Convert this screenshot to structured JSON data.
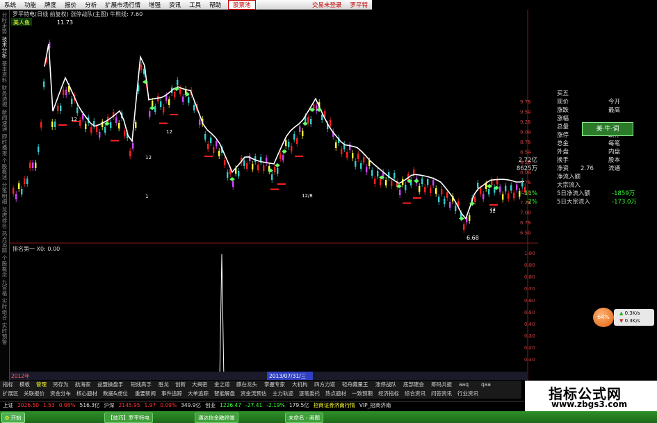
{
  "menu": {
    "items": [
      "系统",
      "功能",
      "牌度",
      "报价",
      "分析",
      "扩展市场行情",
      "增强",
      "资讯",
      "工具",
      "帮助"
    ],
    "special": "股票池",
    "right_items": [
      "交易未登录",
      "罗平特"
    ]
  },
  "left_tabs": [
    "分时走势",
    "技术分析",
    "基本资料",
    "财务透视",
    "新闻速递",
    "即时播报",
    "个股概述",
    "分笔明细",
    "龙虎排名",
    "热点追踪",
    "个股概念",
    "九宫格",
    "实时组合",
    "实时预警"
  ],
  "chart": {
    "title": "罗平特电(日线 前复权) 涨停战队(主图) 牛熊线: 7.60",
    "strategy_label": "美人鱼",
    "peak_label": "11.73",
    "low_label": "6.68",
    "indicator_title": "排名第一  X0: 0.00",
    "date_label": "2013/07/31/三",
    "date_start": "2012年",
    "price_ticks": [
      "9.75",
      "9.50",
      "9.25",
      "9.00",
      "8.75",
      "8.50",
      "8.25",
      "8.00",
      "7.75",
      "7.50",
      "7.25",
      "7.00",
      "6.75",
      "6.50"
    ],
    "indicator_ticks": [
      "1.00",
      "0.90",
      "0.80",
      "0.70",
      "0.60",
      "0.50",
      "0.40",
      "0.30",
      "0.20",
      "0.10"
    ],
    "markers": [
      "12",
      "12",
      "12",
      "1",
      "12",
      "12",
      "12/8"
    ],
    "colors": {
      "white_line": "#ffffff",
      "yellow": "#ffff33",
      "magenta": "#cc44ff",
      "cyan": "#33cccc",
      "red": "#ff2020",
      "green_sign": "#66ff66"
    }
  },
  "right_panel": {
    "rows": [
      {
        "label": "买五",
        "value": "",
        "label2": "",
        "value2": ""
      },
      {
        "label": "现价",
        "value": "",
        "label2": "今开",
        "value2": ""
      },
      {
        "label": "涨跌",
        "value": "",
        "label2": "最高",
        "value2": ""
      },
      {
        "label": "涨幅",
        "value": "",
        "label2": "",
        "value2": ""
      },
      {
        "label": "总量",
        "value": "",
        "label2": "",
        "value2": ""
      },
      {
        "label": "涨停",
        "value": "",
        "label2": "跌停",
        "value2": ""
      },
      {
        "label": "总金",
        "value": "",
        "label2": "每笔",
        "value2": ""
      },
      {
        "label": "外盘",
        "value": "",
        "label2": "内盘",
        "value2": ""
      },
      {
        "label": "换手",
        "value": "",
        "label2": "股本",
        "value2": "2.72亿"
      },
      {
        "label": "净资",
        "value": "2.76",
        "label2": "流通",
        "value2": "8625万"
      },
      {
        "label": "净流入额",
        "value": "",
        "label2": "",
        "value2": ""
      },
      {
        "label": "大宗流入",
        "value": "",
        "label2": "",
        "value2": ""
      },
      {
        "label": "5日净流入额",
        "value": "-1859万",
        "label2": "",
        "value2": "-11%"
      },
      {
        "label": "5日大宗流入",
        "value": "-173.0万",
        "label2": "",
        "value2": "-2%"
      }
    ],
    "badge": "美·牛·词"
  },
  "speed_widget": {
    "percent": "64%",
    "up": "0.3K/s",
    "down": "0.3K/s"
  },
  "bottom_tabs": [
    "指标",
    "模板",
    "管理",
    "另存为",
    "航海家",
    "益盟操盘手",
    "短线高手",
    "胜龙",
    "创新",
    "大揭密",
    "金之道",
    "麒在龙头",
    "掌握专家",
    "大机构",
    "四方力道",
    "轻舟藏量王",
    "涨停战队",
    "底部建会",
    "筹码共振",
    "aaq",
    "qaa"
  ],
  "bottom_tabs_row2": [
    "扩展区",
    "关联报价",
    "资金分布",
    "核心题材",
    "数据&虎位",
    "重要新闻",
    "事件追踪",
    "大单追踪",
    "智能解盘",
    "资金流预估",
    "主力轨迹",
    "逐笔委托",
    "热点题材",
    "一致预期",
    "经济指标",
    "综合资讯",
    "问答资讯",
    "行业资讯"
  ],
  "status_bar": [
    {
      "text": "上证",
      "color": "#dddddd"
    },
    {
      "text": "2026.50",
      "color": "#ff3333"
    },
    {
      "text": "1.53",
      "color": "#ff3333"
    },
    {
      "text": "0.08%",
      "color": "#ff3333"
    },
    {
      "text": "516.3亿",
      "color": "#dddddd"
    },
    {
      "text": "沪深",
      "color": "#dddddd"
    },
    {
      "text": "2145.95",
      "color": "#ff3333"
    },
    {
      "text": "1.97",
      "color": "#ff3333"
    },
    {
      "text": "0.09%",
      "color": "#ff3333"
    },
    {
      "text": "349.9亿",
      "color": "#dddddd"
    },
    {
      "text": "创业",
      "color": "#dddddd"
    },
    {
      "text": "1226.47",
      "color": "#33ff33"
    },
    {
      "text": "-27.41",
      "color": "#33ff33"
    },
    {
      "text": "-2.19%",
      "color": "#33ff33"
    },
    {
      "text": "179.5亿",
      "color": "#dddddd"
    },
    {
      "text": "招商证券济南行情",
      "color": "#ffff33"
    },
    {
      "text": "VIP_招商济南",
      "color": "#dddddd"
    }
  ],
  "taskbar": {
    "start": "开始",
    "items": [
      "【技巧】罗平特电",
      "通达信金融终端",
      "未命名 - 画图"
    ]
  },
  "watermark": {
    "title": "指标公式网",
    "url": "www.zbgs3.com"
  }
}
